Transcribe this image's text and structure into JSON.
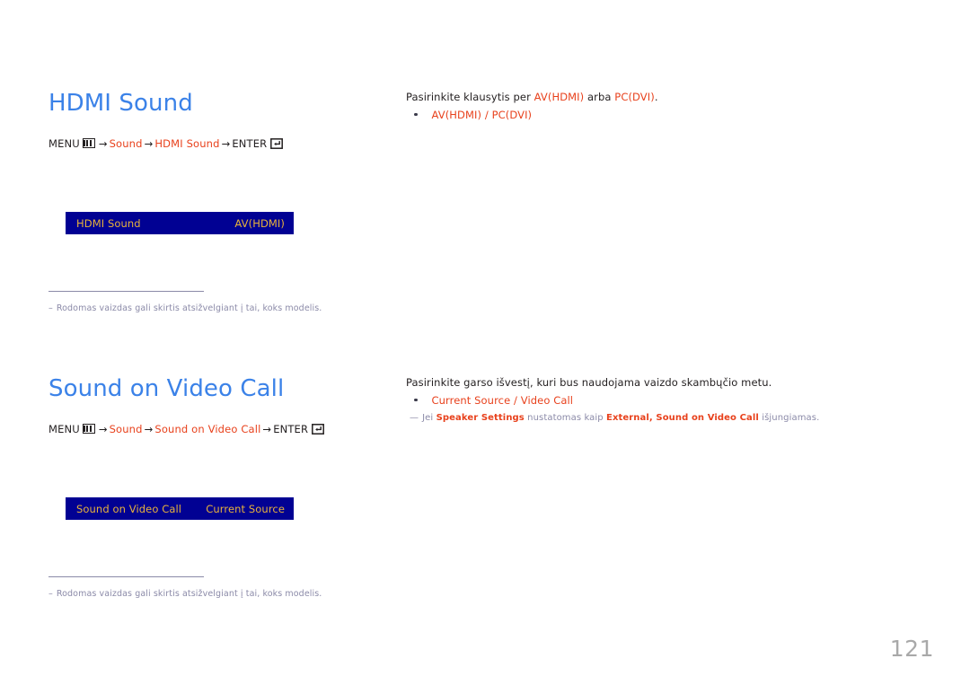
{
  "document": {
    "page_number": "121",
    "language": "lt",
    "colors": {
      "heading_blue": "#3b82e8",
      "accent_red": "#e8411c",
      "osd_background": "#010193",
      "osd_text": "#e8b23c",
      "note_gray": "#8b8aa8",
      "body_text": "#231f20",
      "page_number_gray": "#a9a9a9"
    }
  },
  "sections": [
    {
      "id": "hdmi-sound",
      "heading": "HDMI Sound",
      "menu_path": {
        "menu_label": "MENU",
        "menu_icon": "menu-grid-icon",
        "arrow": "→",
        "steps": [
          {
            "label": "Sound",
            "highlight": true
          },
          {
            "label": "HDMI Sound",
            "highlight": true
          }
        ],
        "enter_label": "ENTER",
        "enter_icon": "enter-return-icon"
      },
      "osd": {
        "label": "HDMI Sound",
        "value": "AV(HDMI)"
      },
      "note": {
        "dash": "–",
        "text": "Rodomas vaizdas gali skirtis atsižvelgiant į tai, koks modelis."
      },
      "right": {
        "lead": {
          "before": "Pasirinkite klausytis per ",
          "term1": "AV(HDMI)",
          "middle": " arba ",
          "term2": "PC(DVI)",
          "after": "."
        },
        "bullet": {
          "option1": "AV(HDMI)",
          "separator": " / ",
          "option2": "PC(DVI)"
        },
        "note": null
      }
    },
    {
      "id": "video-call",
      "heading": "Sound on Video Call",
      "menu_path": {
        "menu_label": "MENU",
        "menu_icon": "menu-grid-icon",
        "arrow": "→",
        "steps": [
          {
            "label": "Sound",
            "highlight": true
          },
          {
            "label": "Sound on Video Call",
            "highlight": true
          }
        ],
        "enter_label": "ENTER",
        "enter_icon": "enter-return-icon"
      },
      "osd": {
        "label": "Sound on Video Call",
        "value": "Current Source"
      },
      "note": {
        "dash": "–",
        "text": "Rodomas vaizdas gali skirtis atsižvelgiant į tai, koks modelis."
      },
      "right": {
        "lead": {
          "before": "Pasirinkite garso išvestį, kuri bus naudojama vaizdo skambųčio metu.",
          "term1": "",
          "middle": "",
          "term2": "",
          "after": ""
        },
        "bullet": {
          "option1": "Current Source",
          "separator": " / ",
          "option2": "Video Call"
        },
        "note": {
          "dash": "—",
          "p1": "Jei ",
          "t1": "Speaker Settings",
          "p2": " nustatomas kaip ",
          "t2": "External",
          "p3": ", ",
          "t3": "Sound on Video Call",
          "p4": " išjungiamas."
        }
      }
    }
  ]
}
